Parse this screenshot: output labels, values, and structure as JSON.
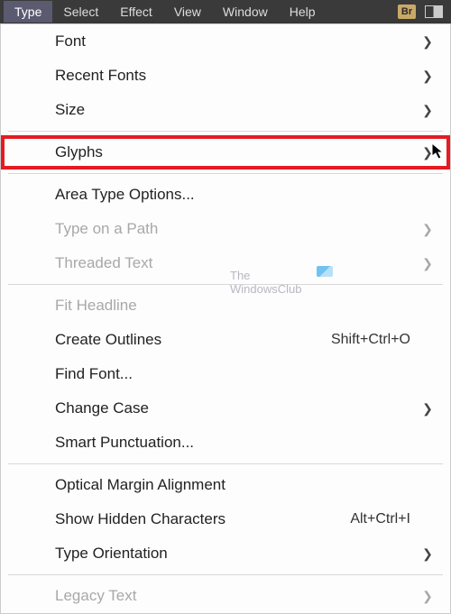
{
  "menubar": {
    "items": [
      {
        "label": "Type",
        "active": true
      },
      {
        "label": "Select",
        "active": false
      },
      {
        "label": "Effect",
        "active": false
      },
      {
        "label": "View",
        "active": false
      },
      {
        "label": "Window",
        "active": false
      },
      {
        "label": "Help",
        "active": false
      }
    ],
    "br_label": "Br"
  },
  "menu": [
    {
      "label": "Font",
      "submenu": true
    },
    {
      "label": "Recent Fonts",
      "submenu": true
    },
    {
      "label": "Size",
      "submenu": true
    },
    {
      "sep": true
    },
    {
      "label": "Glyphs",
      "highlighted": true,
      "submenu": true
    },
    {
      "sep": true
    },
    {
      "label": "Area Type Options..."
    },
    {
      "label": "Type on a Path",
      "disabled": true,
      "submenu": true
    },
    {
      "label": "Threaded Text",
      "disabled": true,
      "submenu": true
    },
    {
      "sep": true
    },
    {
      "label": "Fit Headline",
      "disabled": true
    },
    {
      "label": "Create Outlines",
      "shortcut": "Shift+Ctrl+O"
    },
    {
      "label": "Find Font..."
    },
    {
      "label": "Change Case",
      "submenu": true
    },
    {
      "label": "Smart Punctuation..."
    },
    {
      "sep": true
    },
    {
      "label": "Optical Margin Alignment"
    },
    {
      "label": "Show Hidden Characters",
      "shortcut": "Alt+Ctrl+I"
    },
    {
      "label": "Type Orientation",
      "submenu": true
    },
    {
      "sep": true
    },
    {
      "label": "Legacy Text",
      "disabled": true,
      "submenu": true
    }
  ],
  "watermark": {
    "line1": "The",
    "line2": "WindowsClub"
  }
}
